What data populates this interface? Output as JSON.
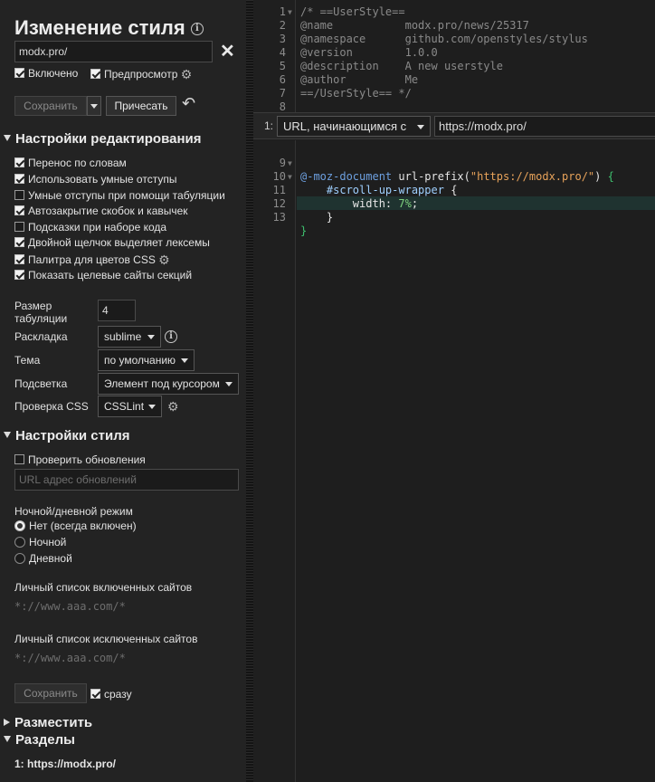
{
  "title": "Изменение стиля",
  "name_input": {
    "value": "modx.pro/"
  },
  "enabled_label": "Включено",
  "preview_label": "Предпросмотр",
  "save_label": "Сохранить",
  "beautify_label": "Причесать",
  "editor_settings": {
    "header": "Настройки редактирования",
    "options": [
      {
        "label": "Перенос по словам",
        "checked": true
      },
      {
        "label": "Использовать умные отступы",
        "checked": true
      },
      {
        "label": "Умные отступы при помощи табуляции",
        "checked": false
      },
      {
        "label": "Автозакрытие скобок и кавычек",
        "checked": true
      },
      {
        "label": "Подсказки при наборе кода",
        "checked": false
      },
      {
        "label": "Двойной щелчок выделяет лексемы",
        "checked": true
      },
      {
        "label": "Палитра для цветов CSS",
        "checked": true
      },
      {
        "label": "Показать целевые сайты секций",
        "checked": true
      }
    ],
    "tab_size_label": "Размер табуляции",
    "tab_size_value": "4",
    "keymap_label": "Раскладка",
    "keymap_value": "sublime",
    "theme_label": "Тема",
    "theme_value": "по умолчанию",
    "highlight_label": "Подсветка",
    "highlight_value": "Элемент под курсором",
    "lint_label": "Проверка CSS",
    "lint_value": "CSSLint"
  },
  "style_settings": {
    "header": "Настройки стиля",
    "check_updates_label": "Проверить обновления",
    "update_url_placeholder": "URL адрес обновлений",
    "night_mode_label": "Ночной/дневной режим",
    "radio_options": [
      {
        "label": "Нет (всегда включен)",
        "selected": true
      },
      {
        "label": "Ночной",
        "selected": false
      },
      {
        "label": "Дневной",
        "selected": false
      }
    ],
    "include_label": "Личный список включенных сайтов",
    "include_placeholder": "*://www.aaa.com/*",
    "exclude_label": "Личный список исключенных сайтов",
    "exclude_placeholder": "*://www.aaa.com/*",
    "save_label": "Сохранить",
    "immediately_label": "сразу"
  },
  "publish_header": "Разместить",
  "sections": {
    "header": "Разделы",
    "items": [
      "1: https://modx.pro/"
    ]
  },
  "editor": {
    "header_lines": [
      {
        "n": "1",
        "text": "/* ==UserStyle=="
      },
      {
        "n": "2",
        "text": "@name           modx.pro/news/25317"
      },
      {
        "n": "3",
        "text": "@namespace      github.com/openstyles/stylus"
      },
      {
        "n": "4",
        "text": "@version        1.0.0"
      },
      {
        "n": "5",
        "text": "@description    A new userstyle"
      },
      {
        "n": "6",
        "text": "@author         Me"
      },
      {
        "n": "7",
        "text": "==/UserStyle== */"
      },
      {
        "n": "8",
        "text": ""
      }
    ],
    "section_index": "1:",
    "section_type": "URL, начинающимся с",
    "section_value": "https://modx.pro/",
    "code_line_numbers": [
      "9",
      "10",
      "11",
      "12",
      "13"
    ],
    "code": {
      "moz_document": "@-moz-document",
      "url_prefix": "url-prefix",
      "url_string": "\"https://modx.pro/\"",
      "selector": "#scroll-up-wrapper",
      "property": "width",
      "value": "7%"
    }
  }
}
